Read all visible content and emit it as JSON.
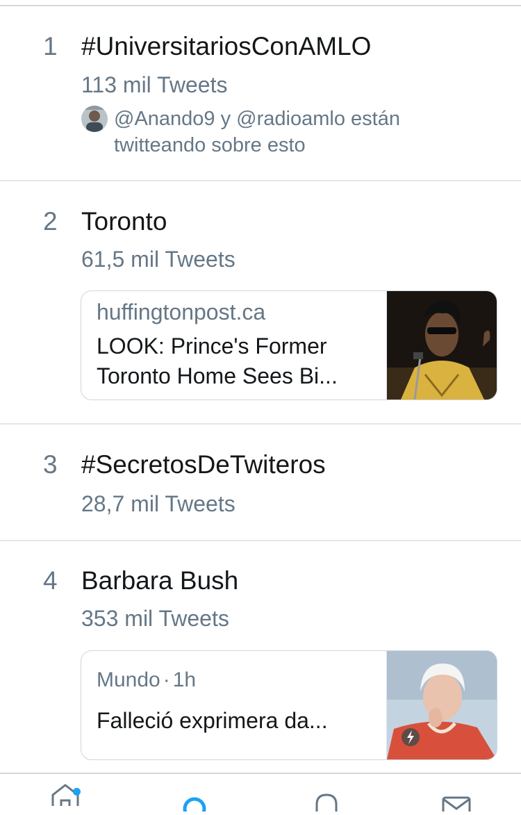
{
  "trends": [
    {
      "rank": "1",
      "name": "#UniversitariosConAMLO",
      "tweet_count": "113 mil Tweets",
      "context": "@Anando9 y @radioamlo están twitteando sobre esto"
    },
    {
      "rank": "2",
      "name": "Toronto",
      "tweet_count": "61,5 mil Tweets",
      "card": {
        "domain": "huffingtonpost.ca",
        "title": "LOOK: Prince's Former Toronto Home Sees Bi..."
      }
    },
    {
      "rank": "3",
      "name": "#SecretosDeTwiteros",
      "tweet_count": "28,7 mil Tweets"
    },
    {
      "rank": "4",
      "name": "Barbara Bush",
      "tweet_count": "353 mil Tweets",
      "card": {
        "category": "Mundo",
        "separator": "·",
        "time": "1h",
        "headline": "Falleció exprimera da..."
      }
    }
  ],
  "tabbar": {
    "items": [
      {
        "icon": "home-icon",
        "active": false,
        "has_notification": true
      },
      {
        "icon": "search-icon",
        "active": true
      },
      {
        "icon": "bell-icon",
        "active": false
      },
      {
        "icon": "mail-icon",
        "active": false
      }
    ]
  },
  "colors": {
    "accent": "#1da1f2",
    "text": "#14171a",
    "secondary": "#657786",
    "divider": "#e1e8ed"
  }
}
